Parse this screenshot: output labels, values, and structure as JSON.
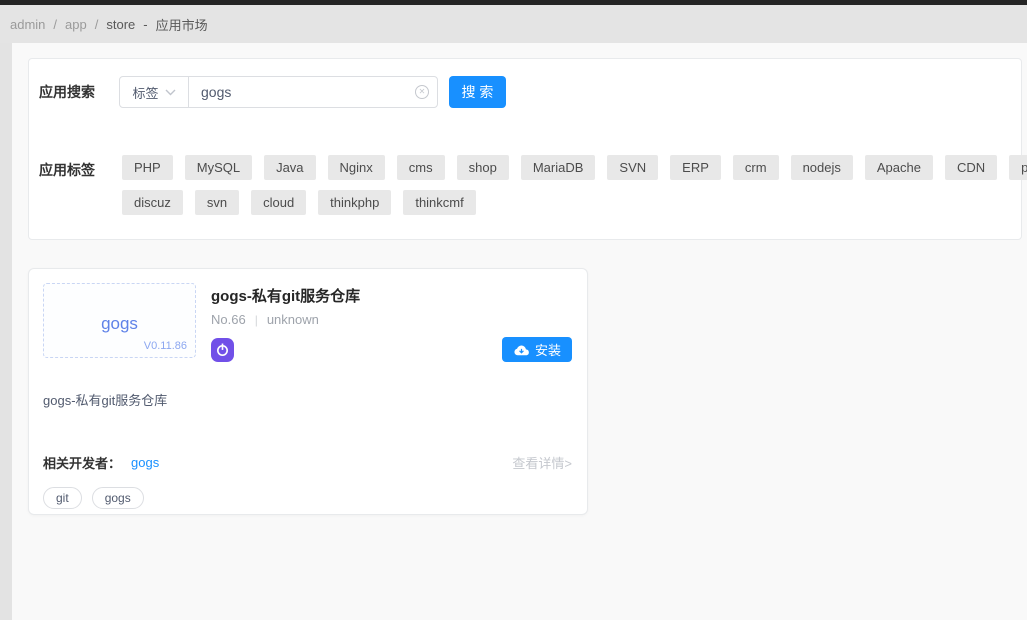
{
  "breadcrumb": {
    "item_admin": "admin",
    "sep1": "/",
    "item_app": "app",
    "sep2": "/",
    "item_store": "store",
    "dash": "-",
    "page_title": "应用市场"
  },
  "search": {
    "label": "应用搜索",
    "select_value": "标签",
    "input_value": "gogs",
    "button_label": "搜 索"
  },
  "tags": {
    "label": "应用标签",
    "rows": [
      [
        "PHP",
        "MySQL",
        "Java",
        "Nginx",
        "cms",
        "shop",
        "MariaDB",
        "SVN",
        "ERP",
        "crm",
        "nodejs",
        "Apache",
        "CDN",
        "phpMyAdmin"
      ],
      [
        "discuz",
        "svn",
        "cloud",
        "thinkphp",
        "thinkcmf"
      ]
    ]
  },
  "app_card": {
    "logo_text": "gogs",
    "version": "V0.11.86",
    "title": "gogs-私有git服务仓库",
    "number": "No.66",
    "meta_divider": "|",
    "status": "unknown",
    "install_label": "安装",
    "description": "gogs-私有git服务仓库",
    "developer_label": "相关开发者：",
    "developer_name": "gogs",
    "details_label": "查看详情>",
    "tags": [
      "git",
      "gogs"
    ]
  },
  "colors": {
    "primary_blue": "#1890ff",
    "app_icon_purple": "#7150e8",
    "logo_blue": "#5f82e8",
    "topbar_black": "#242424",
    "breadcrumb_gray": "#e4e4e4"
  }
}
